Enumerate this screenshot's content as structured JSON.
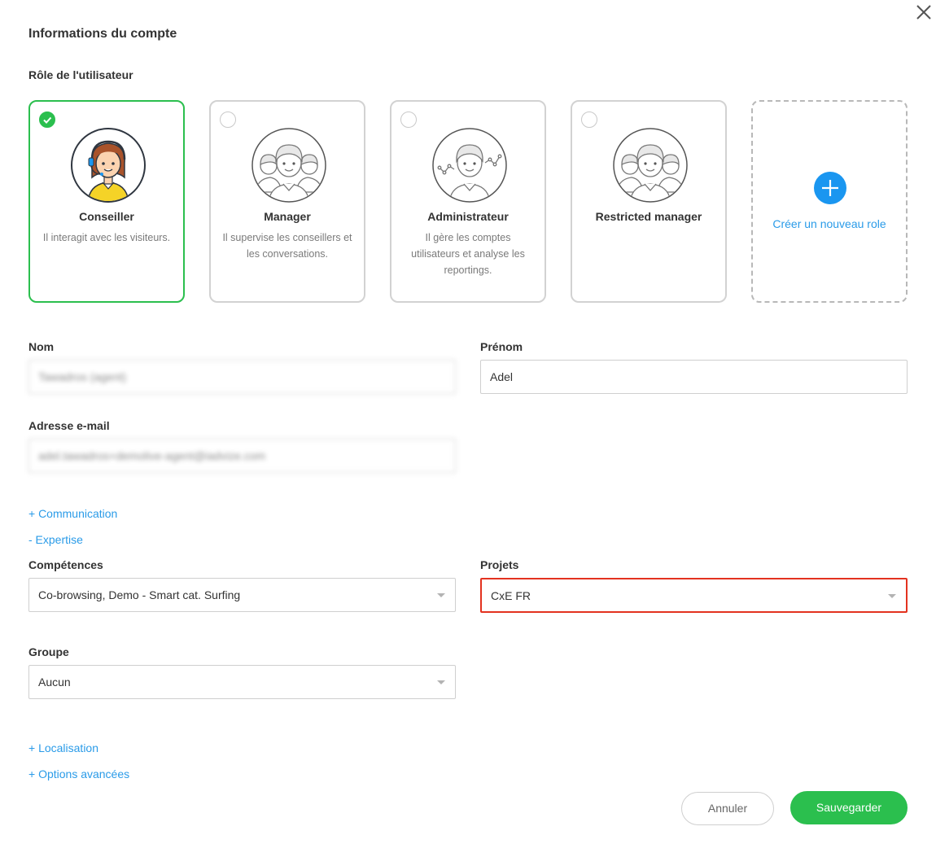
{
  "header": {
    "title": "Informations du compte"
  },
  "role_section": {
    "label": "Rôle de l'utilisateur",
    "roles": [
      {
        "name": "Conseiller",
        "description": "Il interagit avec les visiteurs.",
        "selected": true
      },
      {
        "name": "Manager",
        "description": "Il supervise les conseillers et les conversations.",
        "selected": false
      },
      {
        "name": "Administrateur",
        "description": "Il gère les comptes utilisateurs et analyse les reportings.",
        "selected": false
      },
      {
        "name": "Restricted manager",
        "description": "",
        "selected": false
      }
    ],
    "new_role_label": "Créer un nouveau role"
  },
  "form": {
    "last_name": {
      "label": "Nom",
      "value": "Tawadros (agent)"
    },
    "first_name": {
      "label": "Prénom",
      "value": "Adel"
    },
    "email": {
      "label": "Adresse e-mail",
      "value": "adel.tawadros+demolive-agent@iadvize.com"
    },
    "communication_link": "+ Communication",
    "expertise_link": "- Expertise",
    "skills": {
      "label": "Compétences",
      "value": "Co-browsing, Demo - Smart cat. Surfing"
    },
    "projects": {
      "label": "Projets",
      "value": "CxE FR"
    },
    "group": {
      "label": "Groupe",
      "value": "Aucun"
    },
    "localisation_link": "+ Localisation",
    "advanced_options_link": "+ Options avancées"
  },
  "actions": {
    "cancel_label": "Annuler",
    "save_label": "Sauvegarder"
  },
  "colors": {
    "selected_border": "#2bbf4e",
    "link": "#2a9be8",
    "primary_button": "#2bbf4e",
    "add_button": "#1a96f0",
    "highlight_border": "#e3321f"
  },
  "icons": {
    "close": "close-icon",
    "check": "check-icon",
    "plus": "plus-icon",
    "caret": "caret-down-icon"
  }
}
